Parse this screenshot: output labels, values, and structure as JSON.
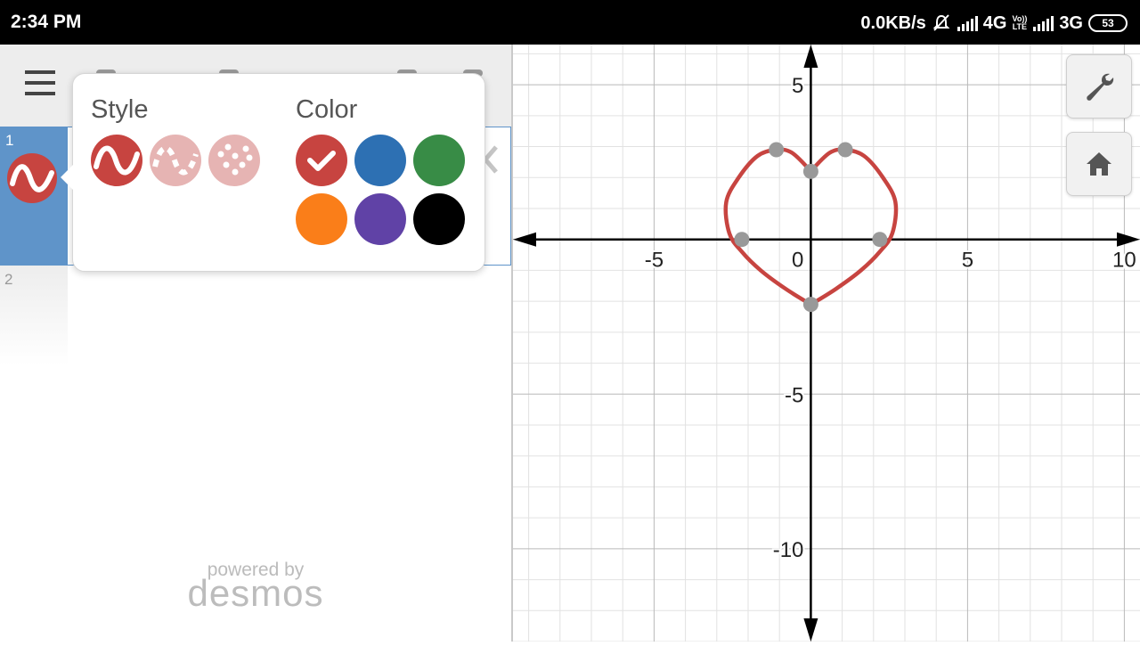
{
  "status_bar": {
    "time": "2:34 PM",
    "net_speed": "0.0KB/s",
    "network1": "4G",
    "volte_line1": "Vo))",
    "volte_line2": "LTE",
    "network2": "3G",
    "battery": "53",
    "icons": [
      "mute-alarm-icon",
      "signal-icon",
      "signal-icon",
      "battery-icon"
    ]
  },
  "expressions": {
    "toolbar_icons": [
      "menu-icon"
    ],
    "rows": [
      {
        "number": "1",
        "style": "line",
        "color": "#c74440"
      },
      {
        "number": "2"
      }
    ]
  },
  "style_popover": {
    "style_heading": "Style",
    "color_heading": "Color",
    "styles": [
      "solid",
      "dashed",
      "dotted"
    ],
    "selected_style": "solid",
    "colors": [
      "#c74440",
      "#2d70b3",
      "#388c46",
      "#fa7e19",
      "#6042a6",
      "#000000"
    ],
    "selected_color": "#c74440"
  },
  "branding": {
    "powered_by": "powered by",
    "brand": "desmos"
  },
  "graph": {
    "x_tick_labels": [
      "-5",
      "0",
      "5",
      "10"
    ],
    "y_tick_labels": [
      "5",
      "-5",
      "-10"
    ],
    "xlim": [
      -9.5,
      10.5
    ],
    "ylim": [
      -13,
      6.3
    ],
    "curve_color": "#c74440",
    "point_color": "#999999",
    "tools": [
      "wrench-icon",
      "home-icon"
    ]
  },
  "chart_data": {
    "type": "line",
    "xlim": [
      -9.5,
      10.5
    ],
    "ylim": [
      -13,
      6.3
    ],
    "grid": true,
    "series": [
      {
        "style": "solid",
        "color": "#c74440",
        "x": [
          0,
          0.6,
          1.1,
          1.7,
          2.3,
          2.7,
          2.6,
          2.2,
          1.6,
          0.8,
          0,
          -0.8,
          -1.6,
          -2.2,
          -2.6,
          -2.7,
          -2.3,
          -1.7,
          -1.1,
          -0.6,
          0
        ],
        "y": [
          2.2,
          2.8,
          2.9,
          2.7,
          2.0,
          1.2,
          0.2,
          -0.4,
          -1.0,
          -1.6,
          -2.1,
          -1.6,
          -1.0,
          -0.4,
          0.2,
          1.2,
          2.0,
          2.7,
          2.9,
          2.8,
          2.2
        ]
      }
    ],
    "points": [
      {
        "x": -1.1,
        "y": 2.9
      },
      {
        "x": 1.1,
        "y": 2.9
      },
      {
        "x": 0,
        "y": 2.2
      },
      {
        "x": -2.2,
        "y": 0
      },
      {
        "x": 2.2,
        "y": 0
      },
      {
        "x": 0,
        "y": -2.1
      }
    ]
  }
}
